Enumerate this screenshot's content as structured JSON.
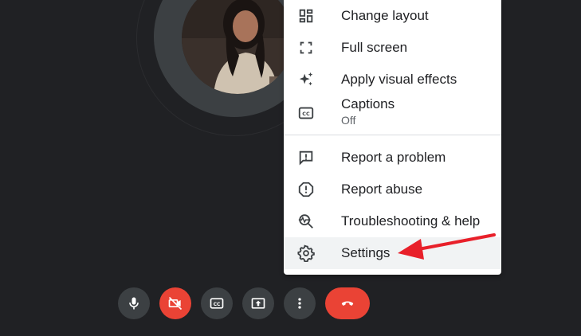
{
  "menu": {
    "items": [
      {
        "label": "Change layout",
        "icon": "change-layout-icon"
      },
      {
        "label": "Full screen",
        "icon": "fullscreen-icon"
      },
      {
        "label": "Apply visual effects",
        "icon": "sparkle-icon"
      },
      {
        "label": "Captions",
        "sublabel": "Off",
        "icon": "captions-icon"
      },
      {
        "label": "Report a problem",
        "icon": "report-problem-icon"
      },
      {
        "label": "Report abuse",
        "icon": "report-abuse-icon"
      },
      {
        "label": "Troubleshooting & help",
        "icon": "troubleshooting-icon"
      },
      {
        "label": "Settings",
        "icon": "gear-icon",
        "highlighted": true
      }
    ]
  },
  "controls": [
    {
      "name": "microphone",
      "icon": "microphone-icon"
    },
    {
      "name": "camera-off",
      "icon": "camera-off-icon",
      "color": "#ea4335"
    },
    {
      "name": "captions",
      "icon": "captions-icon"
    },
    {
      "name": "present",
      "icon": "present-screen-icon"
    },
    {
      "name": "more-options",
      "icon": "more-vert-icon"
    },
    {
      "name": "leave-call",
      "icon": "hang-up-icon",
      "color": "#ea4335"
    }
  ],
  "colors": {
    "background": "#202124",
    "menu_background": "#ffffff",
    "highlight": "#f1f3f4",
    "control_background": "#3c4043",
    "danger": "#ea4335",
    "annotation_arrow": "#e8202a"
  }
}
